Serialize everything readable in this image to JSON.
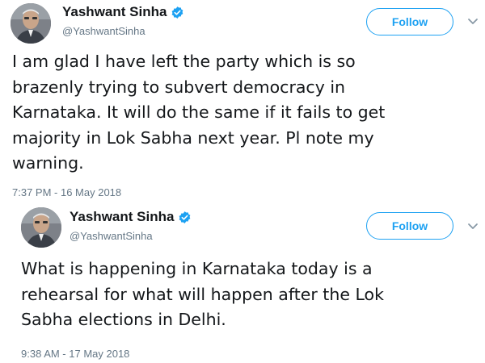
{
  "tweets": [
    {
      "author": {
        "display_name": "Yashwant Sinha",
        "handle": "@YashwantSinha",
        "verified": true
      },
      "follow_label": "Follow",
      "text_lines": [
        "I am glad I have left the party which is so",
        "brazenly trying to subvert democracy in",
        "Karnataka. It will do the same if it fails to get",
        "majority in Lok Sabha next year. Pl note my",
        "warning."
      ],
      "timestamp": "7:37 PM - 16 May 2018"
    },
    {
      "author": {
        "display_name": "Yashwant Sinha",
        "handle": "@YashwantSinha",
        "verified": true
      },
      "follow_label": "Follow",
      "text_lines": [
        "What is happening in Karnataka today is a",
        "rehearsal for what will happen after the Lok",
        "Sabha elections in Delhi."
      ],
      "timestamp": "9:38 AM - 17 May 2018"
    }
  ],
  "icons": {
    "verified": "verified-badge-icon",
    "menu": "chevron-down-icon",
    "avatar": "user-photo"
  },
  "colors": {
    "accent": "#1da1f2",
    "secondary_text": "#657786",
    "primary_text": "#14171a",
    "chevron": "#8899a6"
  }
}
